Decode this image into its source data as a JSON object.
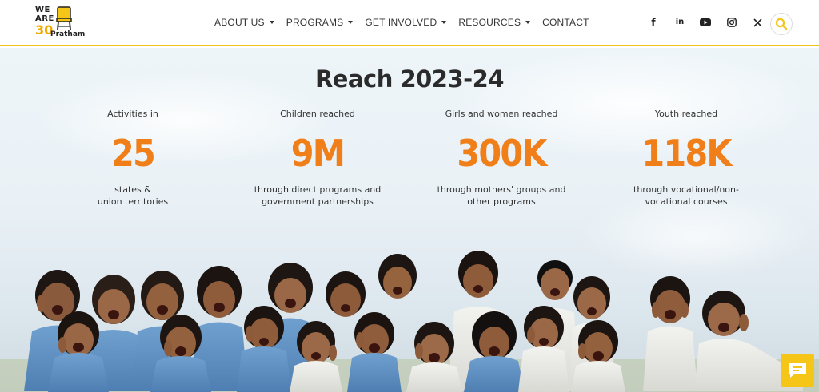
{
  "logo": {
    "line1": "WE",
    "line2": "ARE",
    "number": "30",
    "name": "Pratham"
  },
  "nav": [
    {
      "label": "ABOUT US",
      "has_dropdown": true
    },
    {
      "label": "PROGRAMS",
      "has_dropdown": true
    },
    {
      "label": "GET INVOLVED",
      "has_dropdown": true
    },
    {
      "label": "RESOURCES",
      "has_dropdown": true
    },
    {
      "label": "CONTACT",
      "has_dropdown": false
    }
  ],
  "social": [
    {
      "name": "facebook-icon",
      "glyph": "f"
    },
    {
      "name": "linkedin-icon",
      "glyph": "in"
    },
    {
      "name": "youtube-icon",
      "glyph": ""
    },
    {
      "name": "instagram-icon",
      "glyph": ""
    },
    {
      "name": "x-icon",
      "glyph": "𝕏"
    }
  ],
  "hero": {
    "title": "Reach 2023-24",
    "stats": [
      {
        "label": "Activities in",
        "value": "25",
        "desc_line1": "states &",
        "desc_line2": "union territories"
      },
      {
        "label": "Children reached",
        "value": "9M",
        "desc_line1": "through direct programs and",
        "desc_line2": "government partnerships"
      },
      {
        "label": "Girls and women reached",
        "value": "300K",
        "desc_line1": "through mothers' groups and",
        "desc_line2": "other programs"
      },
      {
        "label": "Youth reached",
        "value": "118K",
        "desc_line1": "through vocational/non-",
        "desc_line2": "vocational courses"
      }
    ]
  },
  "colors": {
    "accent_orange": "#f07f1a",
    "accent_yellow": "#f5c518",
    "text_dark": "#2b2b2b"
  }
}
